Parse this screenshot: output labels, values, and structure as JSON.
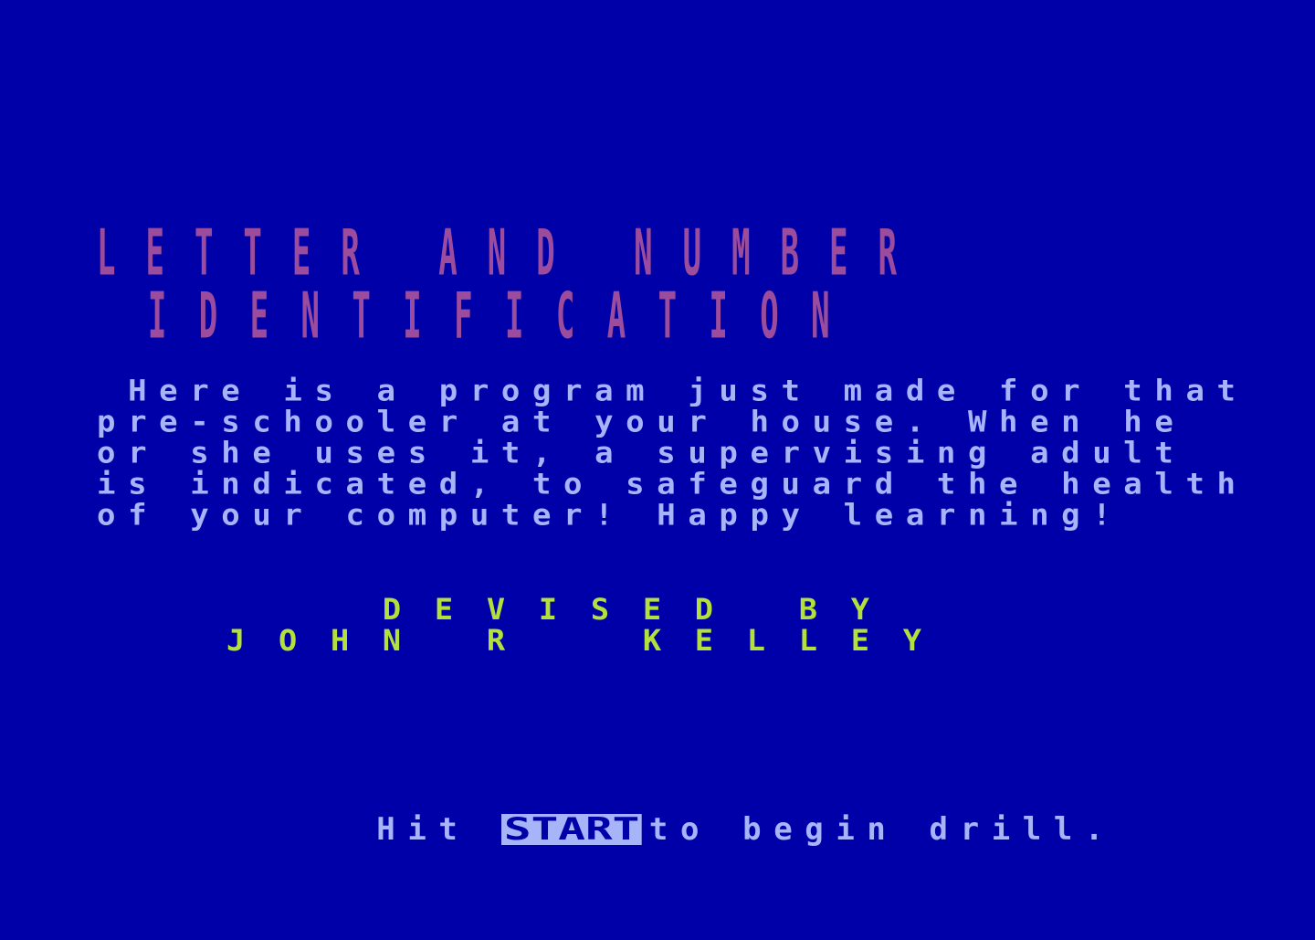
{
  "screen": {
    "title_lines": [
      "LETTER AND NUMBER",
      " IDENTIFICATION"
    ],
    "description_lines": [
      " Here is a program just made for that",
      "pre-schooler at your house. When he",
      "or she uses it, a supervising adult",
      "is indicated, to safeguard the health",
      "of your computer! Happy learning!"
    ],
    "credit_lines": [
      "   DEVISED BY",
      "JOHN R  KELLEY"
    ],
    "prompt": {
      "before": "Hit ",
      "key_label": "START",
      "after": "to begin drill."
    }
  },
  "colors": {
    "background": "#0000a8",
    "title": "#9c4c9c",
    "body_text": "#a8b4f8",
    "credit": "#b4e03c",
    "key_highlight": "#a8b4f8"
  }
}
